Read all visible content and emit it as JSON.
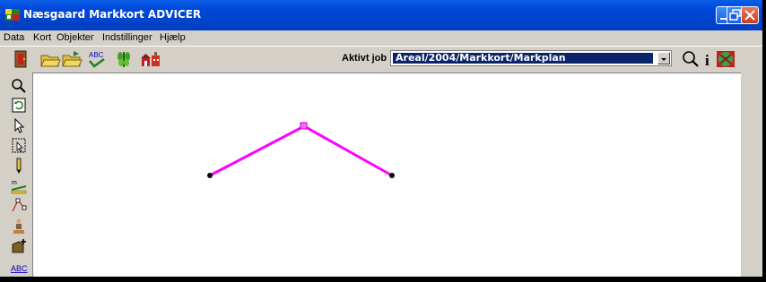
{
  "window": {
    "title": "Næsgaard Markkort ADVICER",
    "title_bar_color": "#0048d8",
    "controls": [
      "minimize-icon",
      "restore-icon",
      "close-icon"
    ]
  },
  "menubar": {
    "items": [
      "Data",
      "Kort",
      "Objekter",
      "Indstillinger",
      "Hjælp"
    ]
  },
  "toolbar": {
    "buttons": [
      "exit-door-icon",
      "open-folder-icon",
      "folder-export-icon",
      "spellcheck-abc-icon",
      "crop-plant-icon",
      "farm-buildings-icon"
    ],
    "active_job_label": "Aktivt job",
    "active_job_value": "Areal/2004/Markkort/Markplan",
    "right_buttons": [
      "magnifier-icon",
      "info-icon",
      "world-map-icon"
    ]
  },
  "left_tools": [
    "zoom-icon",
    "refresh-icon",
    "pointer-icon",
    "select-box-icon",
    "pencil-icon",
    "measure-icon",
    "node-edit-icon",
    "survey-person-icon",
    "add-object-icon",
    "text-abc-icon"
  ],
  "map": {
    "line_color": "#ff00ff",
    "polyline_vertices": 3
  }
}
